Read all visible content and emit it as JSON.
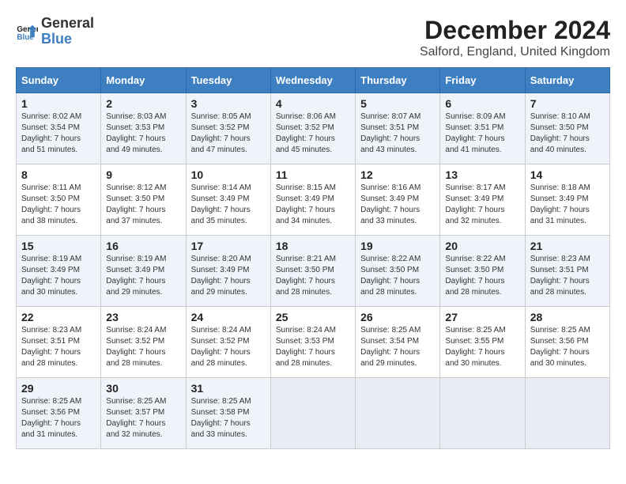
{
  "header": {
    "logo_line1": "General",
    "logo_line2": "Blue",
    "month": "December 2024",
    "location": "Salford, England, United Kingdom"
  },
  "weekdays": [
    "Sunday",
    "Monday",
    "Tuesday",
    "Wednesday",
    "Thursday",
    "Friday",
    "Saturday"
  ],
  "weeks": [
    [
      {
        "day": "1",
        "sunrise": "8:02 AM",
        "sunset": "3:54 PM",
        "daylight": "7 hours and 51 minutes."
      },
      {
        "day": "2",
        "sunrise": "8:03 AM",
        "sunset": "3:53 PM",
        "daylight": "7 hours and 49 minutes."
      },
      {
        "day": "3",
        "sunrise": "8:05 AM",
        "sunset": "3:52 PM",
        "daylight": "7 hours and 47 minutes."
      },
      {
        "day": "4",
        "sunrise": "8:06 AM",
        "sunset": "3:52 PM",
        "daylight": "7 hours and 45 minutes."
      },
      {
        "day": "5",
        "sunrise": "8:07 AM",
        "sunset": "3:51 PM",
        "daylight": "7 hours and 43 minutes."
      },
      {
        "day": "6",
        "sunrise": "8:09 AM",
        "sunset": "3:51 PM",
        "daylight": "7 hours and 41 minutes."
      },
      {
        "day": "7",
        "sunrise": "8:10 AM",
        "sunset": "3:50 PM",
        "daylight": "7 hours and 40 minutes."
      }
    ],
    [
      {
        "day": "8",
        "sunrise": "8:11 AM",
        "sunset": "3:50 PM",
        "daylight": "7 hours and 38 minutes."
      },
      {
        "day": "9",
        "sunrise": "8:12 AM",
        "sunset": "3:50 PM",
        "daylight": "7 hours and 37 minutes."
      },
      {
        "day": "10",
        "sunrise": "8:14 AM",
        "sunset": "3:49 PM",
        "daylight": "7 hours and 35 minutes."
      },
      {
        "day": "11",
        "sunrise": "8:15 AM",
        "sunset": "3:49 PM",
        "daylight": "7 hours and 34 minutes."
      },
      {
        "day": "12",
        "sunrise": "8:16 AM",
        "sunset": "3:49 PM",
        "daylight": "7 hours and 33 minutes."
      },
      {
        "day": "13",
        "sunrise": "8:17 AM",
        "sunset": "3:49 PM",
        "daylight": "7 hours and 32 minutes."
      },
      {
        "day": "14",
        "sunrise": "8:18 AM",
        "sunset": "3:49 PM",
        "daylight": "7 hours and 31 minutes."
      }
    ],
    [
      {
        "day": "15",
        "sunrise": "8:19 AM",
        "sunset": "3:49 PM",
        "daylight": "7 hours and 30 minutes."
      },
      {
        "day": "16",
        "sunrise": "8:19 AM",
        "sunset": "3:49 PM",
        "daylight": "7 hours and 29 minutes."
      },
      {
        "day": "17",
        "sunrise": "8:20 AM",
        "sunset": "3:49 PM",
        "daylight": "7 hours and 29 minutes."
      },
      {
        "day": "18",
        "sunrise": "8:21 AM",
        "sunset": "3:50 PM",
        "daylight": "7 hours and 28 minutes."
      },
      {
        "day": "19",
        "sunrise": "8:22 AM",
        "sunset": "3:50 PM",
        "daylight": "7 hours and 28 minutes."
      },
      {
        "day": "20",
        "sunrise": "8:22 AM",
        "sunset": "3:50 PM",
        "daylight": "7 hours and 28 minutes."
      },
      {
        "day": "21",
        "sunrise": "8:23 AM",
        "sunset": "3:51 PM",
        "daylight": "7 hours and 28 minutes."
      }
    ],
    [
      {
        "day": "22",
        "sunrise": "8:23 AM",
        "sunset": "3:51 PM",
        "daylight": "7 hours and 28 minutes."
      },
      {
        "day": "23",
        "sunrise": "8:24 AM",
        "sunset": "3:52 PM",
        "daylight": "7 hours and 28 minutes."
      },
      {
        "day": "24",
        "sunrise": "8:24 AM",
        "sunset": "3:52 PM",
        "daylight": "7 hours and 28 minutes."
      },
      {
        "day": "25",
        "sunrise": "8:24 AM",
        "sunset": "3:53 PM",
        "daylight": "7 hours and 28 minutes."
      },
      {
        "day": "26",
        "sunrise": "8:25 AM",
        "sunset": "3:54 PM",
        "daylight": "7 hours and 29 minutes."
      },
      {
        "day": "27",
        "sunrise": "8:25 AM",
        "sunset": "3:55 PM",
        "daylight": "7 hours and 30 minutes."
      },
      {
        "day": "28",
        "sunrise": "8:25 AM",
        "sunset": "3:56 PM",
        "daylight": "7 hours and 30 minutes."
      }
    ],
    [
      {
        "day": "29",
        "sunrise": "8:25 AM",
        "sunset": "3:56 PM",
        "daylight": "7 hours and 31 minutes."
      },
      {
        "day": "30",
        "sunrise": "8:25 AM",
        "sunset": "3:57 PM",
        "daylight": "7 hours and 32 minutes."
      },
      {
        "day": "31",
        "sunrise": "8:25 AM",
        "sunset": "3:58 PM",
        "daylight": "7 hours and 33 minutes."
      },
      null,
      null,
      null,
      null
    ]
  ],
  "labels": {
    "sunrise": "Sunrise:",
    "sunset": "Sunset:",
    "daylight": "Daylight:"
  }
}
